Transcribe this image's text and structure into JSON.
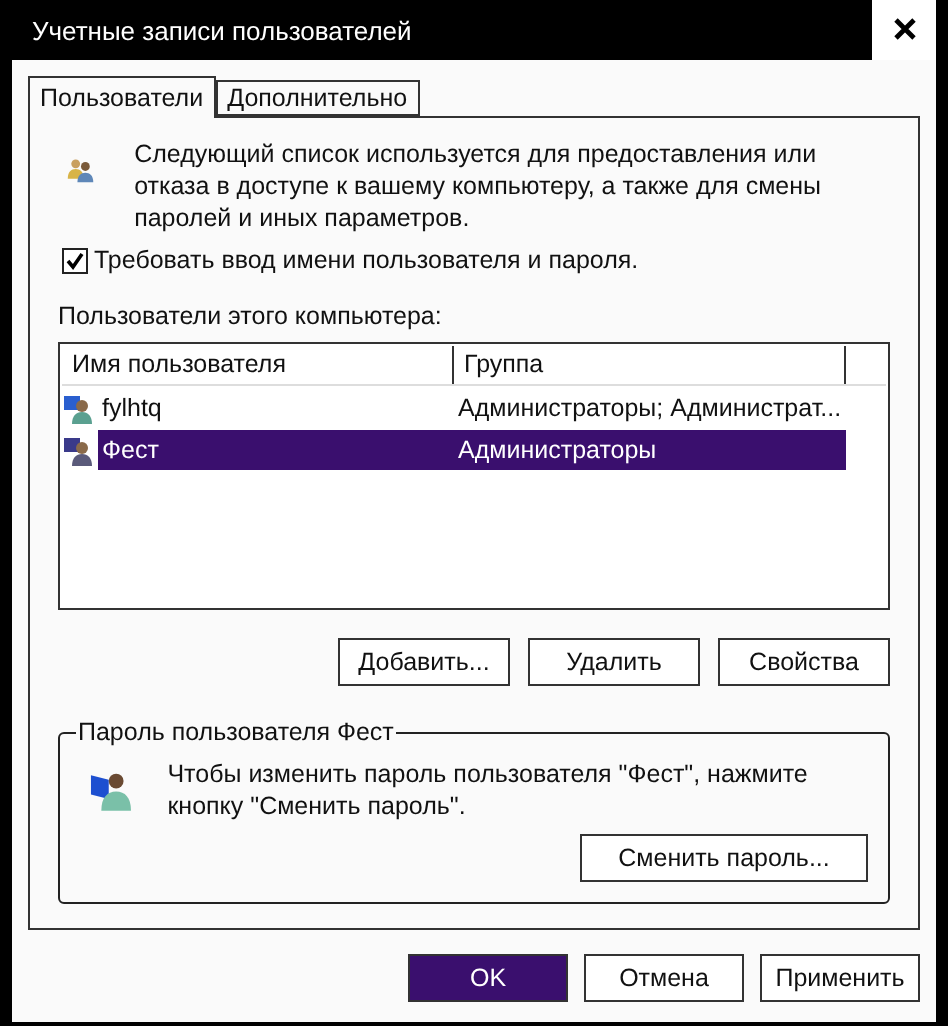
{
  "window": {
    "title": "Учетные записи пользователей"
  },
  "tabs": [
    {
      "label": "Пользователи",
      "selected": true
    },
    {
      "label": "Дополнительно",
      "selected": false
    }
  ],
  "intro": "Следующий список используется для предоставления или отказа в доступе к вашему компьютеру, а также для смены паролей и иных параметров.",
  "require_login": {
    "label": "Требовать ввод имени пользователя и пароля.",
    "checked": true
  },
  "users_label": "Пользователи этого компьютера:",
  "table": {
    "columns": [
      "Имя пользователя",
      "Группа"
    ],
    "rows": [
      {
        "name": "fylhtq",
        "group": "Администраторы; Администрат...",
        "selected": false
      },
      {
        "name": "Фест",
        "group": "Администраторы",
        "selected": true
      }
    ]
  },
  "user_buttons": [
    "Добавить...",
    "Удалить",
    "Свойства"
  ],
  "password_group": {
    "title": "Пароль пользователя Фест",
    "text": "Чтобы изменить пароль пользователя \"Фест\", нажмите кнопку \"Сменить пароль\".",
    "button": "Сменить пароль..."
  },
  "dialog_buttons": [
    {
      "label": "OK",
      "default": true
    },
    {
      "label": "Отмена",
      "default": false
    },
    {
      "label": "Применить",
      "default": false
    }
  ]
}
